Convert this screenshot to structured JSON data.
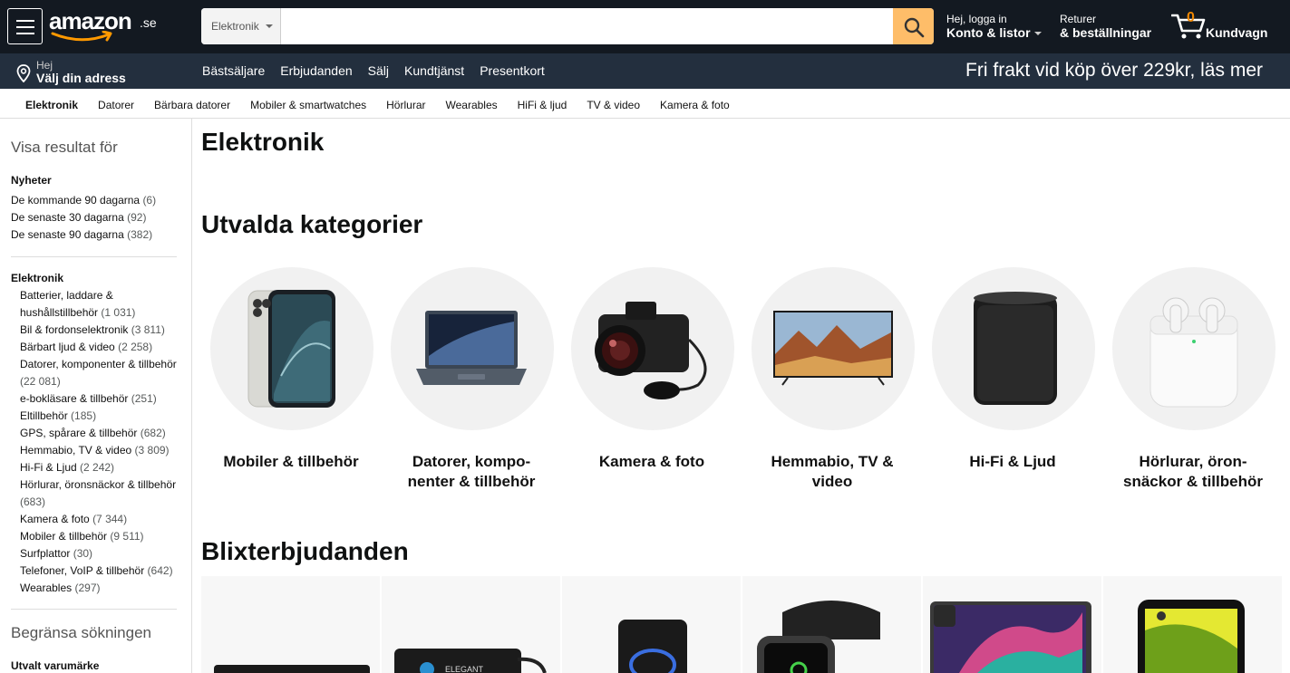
{
  "header": {
    "logo_text": "amazon",
    "logo_tld": ".se",
    "search_category": "Elektronik",
    "search_placeholder": "",
    "account_line1": "Hej, logga in",
    "account_line2": "Konto & listor",
    "orders_line1": "Returer",
    "orders_line2": "& beställningar",
    "cart_count": "0",
    "cart_label": "Kundvagn"
  },
  "subnav": {
    "address_line1": "Hej",
    "address_line2": "Välj din adress",
    "links": [
      "Bästsäljare",
      "Erbjudanden",
      "Sälj",
      "Kundtjänst",
      "Presentkort"
    ],
    "promo": "Fri frakt vid köp över 229kr, läs mer"
  },
  "category_bar": [
    "Elektronik",
    "Datorer",
    "Bärbara datorer",
    "Mobiler & smartwatches",
    "Hörlurar",
    "Wearables",
    "HiFi & ljud",
    "TV & video",
    "Kamera & foto"
  ],
  "sidebar": {
    "heading": "Visa resultat för",
    "new_heading": "Nyheter",
    "new_items": [
      {
        "label": "De kommande 90 dagarna",
        "count": "(6)"
      },
      {
        "label": "De senaste 30 dagarna",
        "count": "(92)"
      },
      {
        "label": "De senaste 90 dagarna",
        "count": "(382)"
      }
    ],
    "dept_heading": "Elektronik",
    "dept_items": [
      {
        "label": "Batterier, laddare & hushållstillbehör",
        "count": "(1 031)"
      },
      {
        "label": "Bil & fordonselektronik",
        "count": "(3 811)"
      },
      {
        "label": "Bärbart ljud & video",
        "count": "(2 258)"
      },
      {
        "label": "Datorer, komponenter & tillbehör",
        "count": "(22 081)"
      },
      {
        "label": "e-bokläsare & tillbehör",
        "count": "(251)"
      },
      {
        "label": "Eltillbehör",
        "count": "(185)"
      },
      {
        "label": "GPS, spårare & tillbehör",
        "count": "(682)"
      },
      {
        "label": "Hemmabio, TV & video",
        "count": "(3 809)"
      },
      {
        "label": "Hi-Fi & Ljud",
        "count": "(2 242)"
      },
      {
        "label": "Hörlurar, öronsnäckor & tillbehör",
        "count": "(683)"
      },
      {
        "label": "Kamera & foto",
        "count": "(7 344)"
      },
      {
        "label": "Mobiler & tillbehör",
        "count": "(9 511)"
      },
      {
        "label": "Surfplattor",
        "count": "(30)"
      },
      {
        "label": "Telefoner, VoIP & tillbehör",
        "count": "(642)"
      },
      {
        "label": "Wearables",
        "count": "(297)"
      }
    ],
    "refine_heading": "Begränsa sökningen",
    "brand_heading": "Utvalt varumärke"
  },
  "main": {
    "title": "Elektronik",
    "featured_heading": "Utvalda kategorier",
    "featured": [
      {
        "line1": "Mobiler & tillbehör",
        "line2": "",
        "icon": "smartphone"
      },
      {
        "line1": "Datorer, kompo-",
        "line2": "nenter & tillbehör",
        "icon": "laptop"
      },
      {
        "line1": "Kamera & foto",
        "line2": "",
        "icon": "camera"
      },
      {
        "line1": "Hemmabio, TV &",
        "line2": "video",
        "icon": "tv"
      },
      {
        "line1": "Hi-Fi & Ljud",
        "line2": "",
        "icon": "speaker"
      },
      {
        "line1": "Hörlurar, öron-",
        "line2": "snäckor & tillbehör",
        "icon": "earbuds"
      }
    ],
    "deals_heading": "Blixterbjudanden",
    "deals": [
      "power-bank",
      "hdmi-adapter",
      "party-speaker",
      "smartwatch",
      "tablet",
      "smartphone"
    ]
  },
  "colors": {
    "nav_dark": "#131921",
    "nav_sub": "#232f3e",
    "search_button": "#febd69",
    "cart_count": "#f08804"
  }
}
